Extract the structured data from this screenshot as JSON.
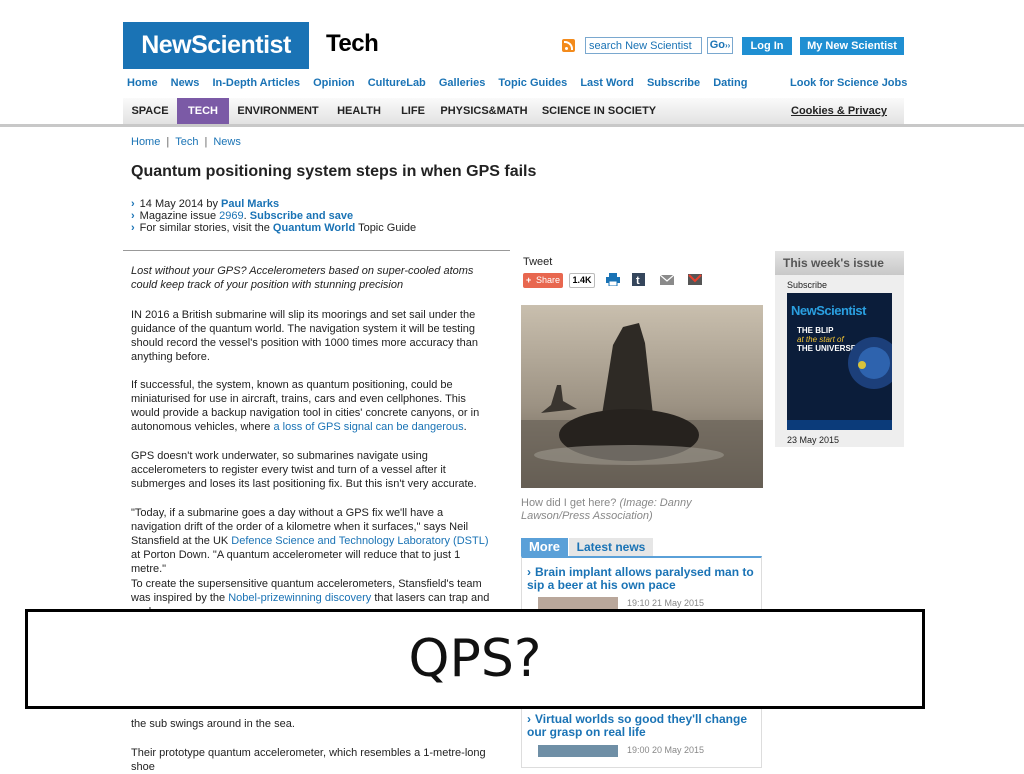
{
  "header": {
    "logo": "NewScientist",
    "section": "Tech",
    "search_placeholder": "search New Scientist",
    "go_label": "Go",
    "login_label": "Log In",
    "my_label": "My New Scientist"
  },
  "topnav": [
    "Home",
    "News",
    "In-Depth Articles",
    "Opinion",
    "CultureLab",
    "Galleries",
    "Topic Guides",
    "Last Word",
    "Subscribe",
    "Dating"
  ],
  "jobs_label": "Look for Science Jobs",
  "categories": [
    "SPACE",
    "TECH",
    "ENVIRONMENT",
    "HEALTH",
    "LIFE",
    "PHYSICS&MATH",
    "SCIENCE IN SOCIETY"
  ],
  "cookies_label": "Cookies & Privacy",
  "breadcrumb": [
    "Home",
    "Tech",
    "News"
  ],
  "article": {
    "headline": "Quantum positioning system steps in when GPS fails",
    "date_prefix": "14 May 2014 by ",
    "author": "Paul Marks",
    "issue_prefix": "Magazine issue ",
    "issue_number": "2969",
    "issue_dot": ". ",
    "subscribe": "Subscribe and save",
    "similar_prefix": "For similar stories, visit the ",
    "topic": "Quantum World",
    "similar_suffix": " Topic Guide",
    "standfirst": "Lost without your GPS? Accelerometers based on super-cooled atoms could keep track of your position with stunning precision",
    "p1": "IN 2016 a British submarine will slip its moorings and set sail under the guidance of the quantum world. The navigation system it will be testing should record the vessel's position with 1000 times more accuracy than anything before.",
    "p2a": "If successful, the system, known as quantum positioning, could be miniaturised for use in aircraft, trains, cars and even cellphones. This would provide a backup navigation tool in cities' concrete canyons, or in autonomous vehicles, where ",
    "p2_link": "a loss of GPS signal can be dangerous",
    "p2b": ".",
    "p3": "GPS doesn't work underwater, so submarines navigate using accelerometers to register every twist and turn of a vessel after it submerges and loses its last positioning fix. But this isn't very accurate.",
    "p4a": "\"Today, if a submarine goes a day without a GPS fix we'll have a navigation drift of the order of a kilometre when it surfaces,\" says Neil Stansfield at the UK ",
    "p4_link": "Defence Science and Technology Laboratory (DSTL)",
    "p4b": " at Porton Down. \"A quantum accelerometer will reduce that to just 1 metre.\"",
    "p5a": "To create the supersensitive quantum accelerometers, Stansfield's team was inspired by the ",
    "p5_link": "Nobel-prizewinning discovery",
    "p5b": " that lasers can trap and cool a",
    "p6_tail": "the sub swings around in the sea.",
    "p7": "Their prototype quantum accelerometer, which resembles a 1-metre-long shoe"
  },
  "social": {
    "tweet": "Tweet",
    "share": "Share",
    "count": "1.4K"
  },
  "photo_caption": {
    "text": "How did I get here? ",
    "credit": "(Image: Danny Lawson/Press Association)"
  },
  "news": {
    "tab_more": "More",
    "tab_latest": "Latest news",
    "items": [
      {
        "title": "Brain implant allows paralysed man to sip a beer at his own pace",
        "time": "19:10 21 May 2015"
      },
      {
        "title": "Virtual worlds so good they'll change our grasp on real life",
        "time": "19:00 20 May 2015"
      }
    ]
  },
  "issue": {
    "heading": "This week's issue",
    "subscribe": "Subscribe",
    "cover_logo": "NewScientist",
    "cover_headline_1": "THE BLIP",
    "cover_headline_2": "at the start of",
    "cover_headline_3": "THE UNIVERSE",
    "date": "23 May 2015"
  },
  "overlay_text": "QPS?",
  "colors": {
    "brand_blue": "#1a73b5",
    "tech_purple": "#7b5aa6",
    "share_red": "#e8674f"
  }
}
